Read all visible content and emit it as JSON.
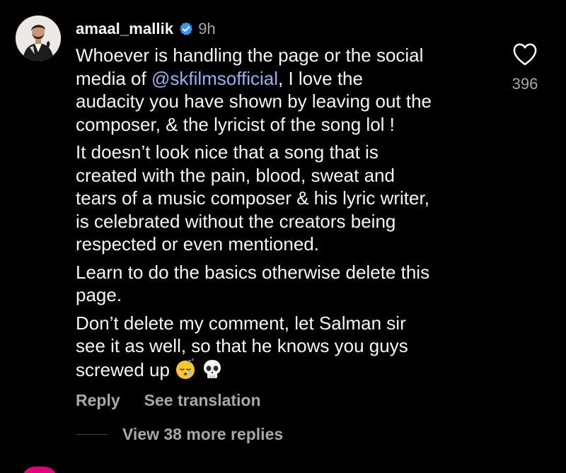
{
  "comment": {
    "username": "amaal_mallik",
    "time": "9h",
    "paragraphs": [
      {
        "lines": [
          {
            "text": "Whoever is handling the page or the social"
          },
          {
            "before": "media of ",
            "mention": "@skfilmsofficial",
            "after": ", I love the"
          },
          {
            "text": "audacity you have shown by leaving out the"
          },
          {
            "text": "composer, & the lyricist of the song lol !"
          }
        ]
      },
      {
        "lines": [
          {
            "text": "It doesn’t look nice that a song that is"
          },
          {
            "text": "created with the pain, blood, sweat and"
          },
          {
            "text": "tears of a music composer & his lyric writer,"
          },
          {
            "text": "is celebrated without the creators being"
          },
          {
            "text": "respected or even mentioned."
          }
        ]
      },
      {
        "lines": [
          {
            "text": "Learn to do the basics otherwise delete this"
          },
          {
            "text": "page."
          }
        ]
      },
      {
        "lines": [
          {
            "text": "Don’t delete my comment, let Salman sir"
          },
          {
            "text": "see it as well, so that he knows you guys"
          },
          {
            "text": "screwed up"
          }
        ]
      }
    ],
    "emojis": [
      "sleeping-face-emoji",
      "skull-emoji"
    ],
    "like_count": "396",
    "actions": {
      "reply": "Reply",
      "see_translation": "See translation"
    },
    "view_replies": "View 38 more replies"
  },
  "icons": {
    "verified": "verified-badge-icon",
    "like": "heart-outline-icon"
  },
  "colors": {
    "background": "#000000",
    "text": "#f5f5f5",
    "secondary": "#a8a8a8",
    "mention": "#98b0f2",
    "verified": "#3897f0",
    "next_avatar_ring": "#e4007c"
  }
}
